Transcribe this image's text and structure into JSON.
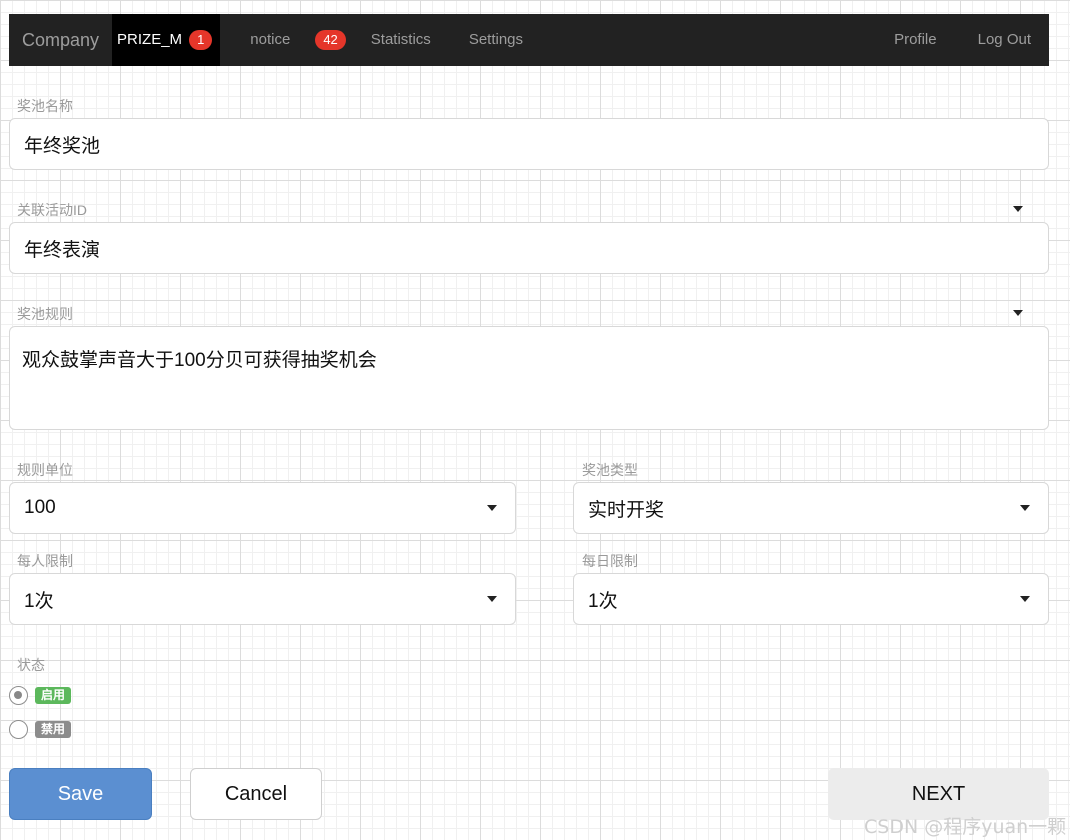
{
  "navbar": {
    "brand": "Company",
    "items": [
      {
        "label": "PRIZE_M",
        "badge": "1",
        "active": true
      },
      {
        "label": "notice",
        "badge": "42"
      },
      {
        "label": "Statistics"
      },
      {
        "label": "Settings"
      }
    ],
    "right": [
      {
        "label": "Profile"
      },
      {
        "label": "Log Out"
      }
    ]
  },
  "form": {
    "pool_name": {
      "label": "奖池名称",
      "value": "年终奖池"
    },
    "activity_id": {
      "label": "关联活动ID",
      "value": "年终表演"
    },
    "pool_rules": {
      "label": "奖池规则",
      "value": "观众鼓掌声音大于100分贝可获得抽奖机会"
    },
    "rule_unit": {
      "label": "规则单位",
      "value": "100"
    },
    "pool_type": {
      "label": "奖池类型",
      "value": "实时开奖"
    },
    "per_person_limit": {
      "label": "每人限制",
      "value": "1次"
    },
    "daily_limit": {
      "label": "每日限制",
      "value": "1次"
    },
    "status": {
      "label": "状态",
      "options": [
        {
          "label": "启用",
          "checked": true,
          "color": "#5cb85c"
        },
        {
          "label": "禁用",
          "checked": false,
          "color": "#8c8c8c"
        }
      ]
    }
  },
  "buttons": {
    "save": "Save",
    "cancel": "Cancel",
    "next": "NEXT"
  },
  "watermark": "CSDN @程序yuan一颗",
  "colors": {
    "navbar_bg": "#222222",
    "badge": "#e5362a",
    "save_button": "#5b8fd1",
    "enabled_tag": "#5cb85c",
    "disabled_tag": "#8c8c8c"
  }
}
